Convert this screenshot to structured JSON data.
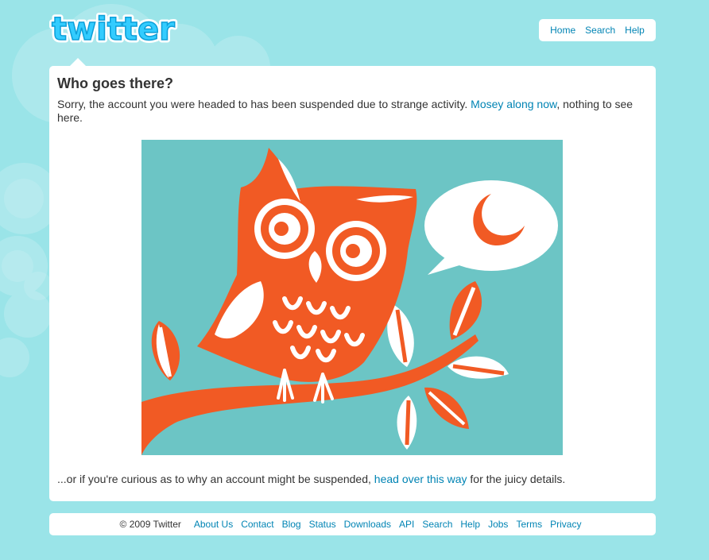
{
  "brand": {
    "logo_text": "twitter",
    "background_color": "#9ae4e8",
    "link_color": "#0084b4",
    "text_color": "#333333"
  },
  "topnav": {
    "items": [
      {
        "label": "Home"
      },
      {
        "label": "Search"
      },
      {
        "label": "Help"
      }
    ]
  },
  "main": {
    "title": "Who goes there?",
    "message_before": "Sorry, the account you were headed to has been suspended due to strange activity. ",
    "message_link": "Mosey along now",
    "message_after": ", nothing to see here.",
    "illustration": {
      "subject": "owl-on-branch-with-speech-bubble",
      "bg_color": "#6cc5c5",
      "owl_color": "#f15a24"
    },
    "bottom_before": "...or if you're curious as to why an account might be suspended, ",
    "bottom_link": "head over this way",
    "bottom_after": " for the juicy details."
  },
  "footer": {
    "copyright": "© 2009 Twitter",
    "links": [
      {
        "label": "About Us"
      },
      {
        "label": "Contact"
      },
      {
        "label": "Blog"
      },
      {
        "label": "Status"
      },
      {
        "label": "Downloads"
      },
      {
        "label": "API"
      },
      {
        "label": "Search"
      },
      {
        "label": "Help"
      },
      {
        "label": "Jobs"
      },
      {
        "label": "Terms"
      },
      {
        "label": "Privacy"
      }
    ]
  }
}
